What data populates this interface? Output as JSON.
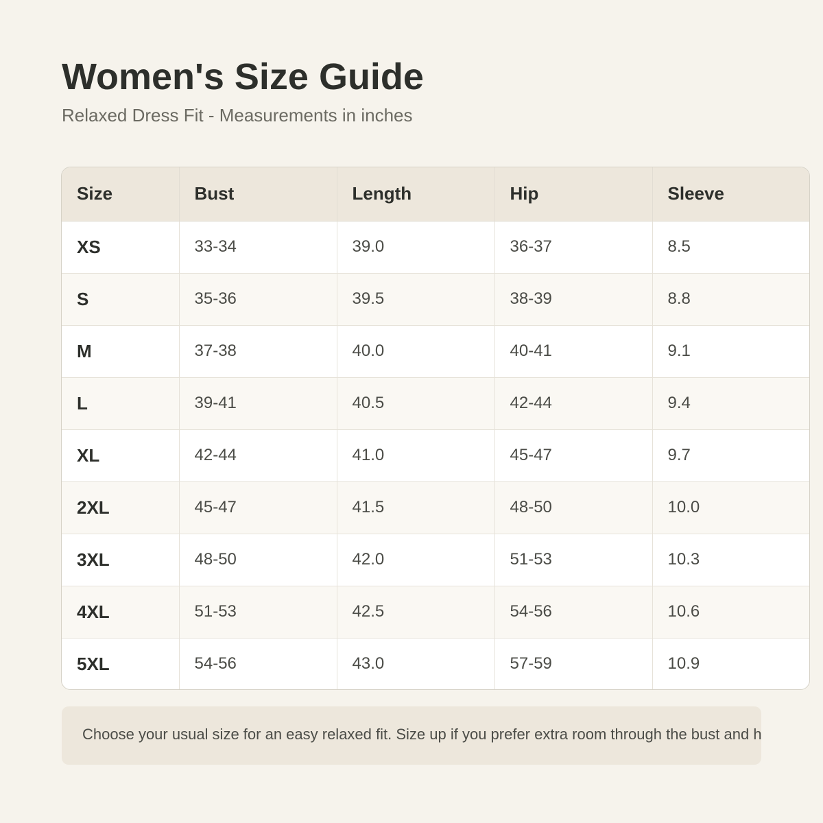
{
  "title": "Women's Size Guide",
  "subtitle": "Relaxed Dress Fit - Measurements in inches",
  "table": {
    "headers": [
      "Size",
      "Bust",
      "Length",
      "Hip",
      "Sleeve"
    ],
    "rows": [
      [
        "XS",
        "33-34",
        "39.0",
        "36-37",
        "8.5"
      ],
      [
        "S",
        "35-36",
        "39.5",
        "38-39",
        "8.8"
      ],
      [
        "M",
        "37-38",
        "40.0",
        "40-41",
        "9.1"
      ],
      [
        "L",
        "39-41",
        "40.5",
        "42-44",
        "9.4"
      ],
      [
        "XL",
        "42-44",
        "41.0",
        "45-47",
        "9.7"
      ],
      [
        "2XL",
        "45-47",
        "41.5",
        "48-50",
        "10.0"
      ],
      [
        "3XL",
        "48-50",
        "42.0",
        "51-53",
        "10.3"
      ],
      [
        "4XL",
        "51-53",
        "42.5",
        "54-56",
        "10.6"
      ],
      [
        "5XL",
        "54-56",
        "43.0",
        "57-59",
        "10.9"
      ]
    ]
  },
  "note": "Choose your usual size for an easy relaxed fit. Size up if you prefer extra room through the bust and hips.",
  "colors": {
    "background": "#f6f3ec",
    "header_fill": "#ede7dc",
    "alt_row_fill": "#faf8f3",
    "text": "#2d2f2b"
  }
}
